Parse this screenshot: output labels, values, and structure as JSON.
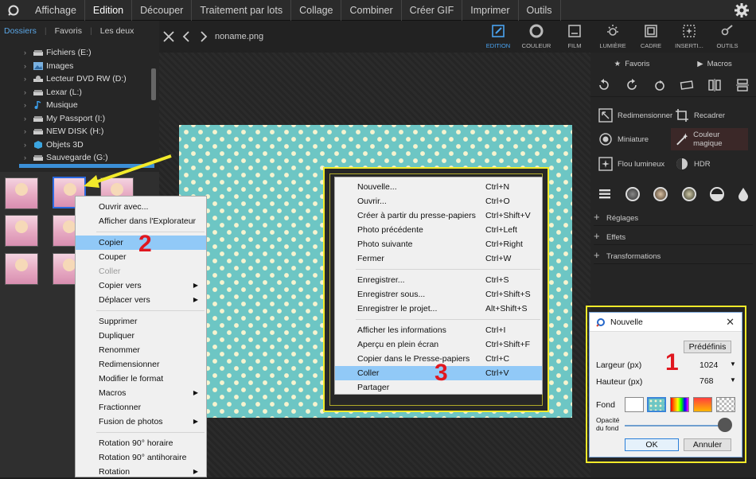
{
  "menubar": {
    "items": [
      "Affichage",
      "Edition",
      "Découper",
      "Traitement par lots",
      "Collage",
      "Combiner",
      "Créer GIF",
      "Imprimer",
      "Outils"
    ],
    "active": "Edition"
  },
  "left_panel": {
    "tabs": [
      "Dossiers",
      "Favoris",
      "Les deux"
    ],
    "tree": [
      {
        "label": "Fichiers (E:)",
        "icon": "drive-icon"
      },
      {
        "label": "Images",
        "icon": "images-folder-icon"
      },
      {
        "label": "Lecteur DVD RW (D:)",
        "icon": "dvd-drive-icon"
      },
      {
        "label": "Lexar (L:)",
        "icon": "drive-icon"
      },
      {
        "label": "Musique",
        "icon": "music-icon"
      },
      {
        "label": "My Passport (I:)",
        "icon": "drive-icon"
      },
      {
        "label": "NEW DISK (H:)",
        "icon": "drive-icon"
      },
      {
        "label": "Objets 3D",
        "icon": "objects-3d-icon"
      },
      {
        "label": "Sauvegarde (G:)",
        "icon": "drive-icon"
      }
    ]
  },
  "viewer": {
    "filename": "noname.png"
  },
  "tools": [
    {
      "label": "EDITION",
      "icon": "edit-icon",
      "active": true
    },
    {
      "label": "COULEUR",
      "icon": "color-icon"
    },
    {
      "label": "FILM",
      "icon": "film-icon"
    },
    {
      "label": "LUMIÈRE",
      "icon": "light-icon"
    },
    {
      "label": "CADRE",
      "icon": "frame-icon"
    },
    {
      "label": "INSERTI...",
      "icon": "insert-icon"
    },
    {
      "label": "OUTILS",
      "icon": "tools-icon"
    }
  ],
  "right_panel": {
    "tabs": {
      "favoris": "Favoris",
      "macros": "Macros"
    },
    "buttons": {
      "redimensionner": "Redimensionner",
      "recadrer": "Recadrer",
      "miniature": "Miniature",
      "couleur_magique": "Couleur magique",
      "flou_lumineux": "Flou lumineux",
      "hdr": "HDR"
    },
    "sections": [
      "Réglages",
      "Effets",
      "Transformations"
    ]
  },
  "context_menu": {
    "items": [
      {
        "label": "Ouvrir avec..."
      },
      {
        "label": "Afficher dans l'Explorateur"
      },
      {
        "sep": true
      },
      {
        "label": "Copier",
        "highlight": true
      },
      {
        "label": "Couper"
      },
      {
        "label": "Coller",
        "disabled": true
      },
      {
        "label": "Copier vers",
        "submenu": true
      },
      {
        "label": "Déplacer vers",
        "submenu": true
      },
      {
        "sep": true
      },
      {
        "label": "Supprimer"
      },
      {
        "label": "Dupliquer"
      },
      {
        "label": "Renommer"
      },
      {
        "label": "Redimensionner"
      },
      {
        "label": "Modifier le format"
      },
      {
        "label": "Macros",
        "submenu": true
      },
      {
        "label": "Fractionner"
      },
      {
        "label": "Fusion de photos",
        "submenu": true
      },
      {
        "sep": true
      },
      {
        "label": "Rotation 90° horaire"
      },
      {
        "label": "Rotation 90° antihoraire"
      },
      {
        "label": "Rotation",
        "submenu": true
      }
    ]
  },
  "paste_menu": {
    "items": [
      {
        "label": "Nouvelle...",
        "shortcut": "Ctrl+N"
      },
      {
        "label": "Ouvrir...",
        "shortcut": "Ctrl+O"
      },
      {
        "label": "Créer à partir du presse-papiers",
        "shortcut": "Ctrl+Shift+V"
      },
      {
        "label": "Photo précédente",
        "shortcut": "Ctrl+Left"
      },
      {
        "label": "Photo suivante",
        "shortcut": "Ctrl+Right"
      },
      {
        "label": "Fermer",
        "shortcut": "Ctrl+W"
      },
      {
        "sep": true
      },
      {
        "label": "Enregistrer...",
        "shortcut": "Ctrl+S"
      },
      {
        "label": "Enregistrer sous...",
        "shortcut": "Ctrl+Shift+S"
      },
      {
        "label": "Enregistrer le projet...",
        "shortcut": "Alt+Shift+S"
      },
      {
        "sep": true
      },
      {
        "label": "Afficher les informations",
        "shortcut": "Ctrl+I"
      },
      {
        "label": "Aperçu en plein écran",
        "shortcut": "Ctrl+Shift+F"
      },
      {
        "label": "Copier dans le Presse-papiers",
        "shortcut": "Ctrl+C"
      },
      {
        "label": "Coller",
        "shortcut": "Ctrl+V",
        "highlight": true
      },
      {
        "label": "Partager",
        "shortcut": ""
      }
    ]
  },
  "dialog": {
    "title": "Nouvelle",
    "predefinis": "Prédéfinis",
    "largeur_label": "Largeur (px)",
    "largeur_value": "1024",
    "hauteur_label": "Hauteur (px)",
    "hauteur_value": "768",
    "fond_label": "Fond",
    "opacite_label": "Opacité du fond",
    "ok": "OK",
    "annuler": "Annuler"
  },
  "annotations": {
    "n1": "1",
    "n2": "2",
    "n3": "3"
  },
  "colors": {
    "accent": "#4aa3f0",
    "highlight": "#91c9f7",
    "annotation": "#e0171f",
    "frame": "#f2ea2a",
    "image_bg": "#6dc6c4"
  }
}
